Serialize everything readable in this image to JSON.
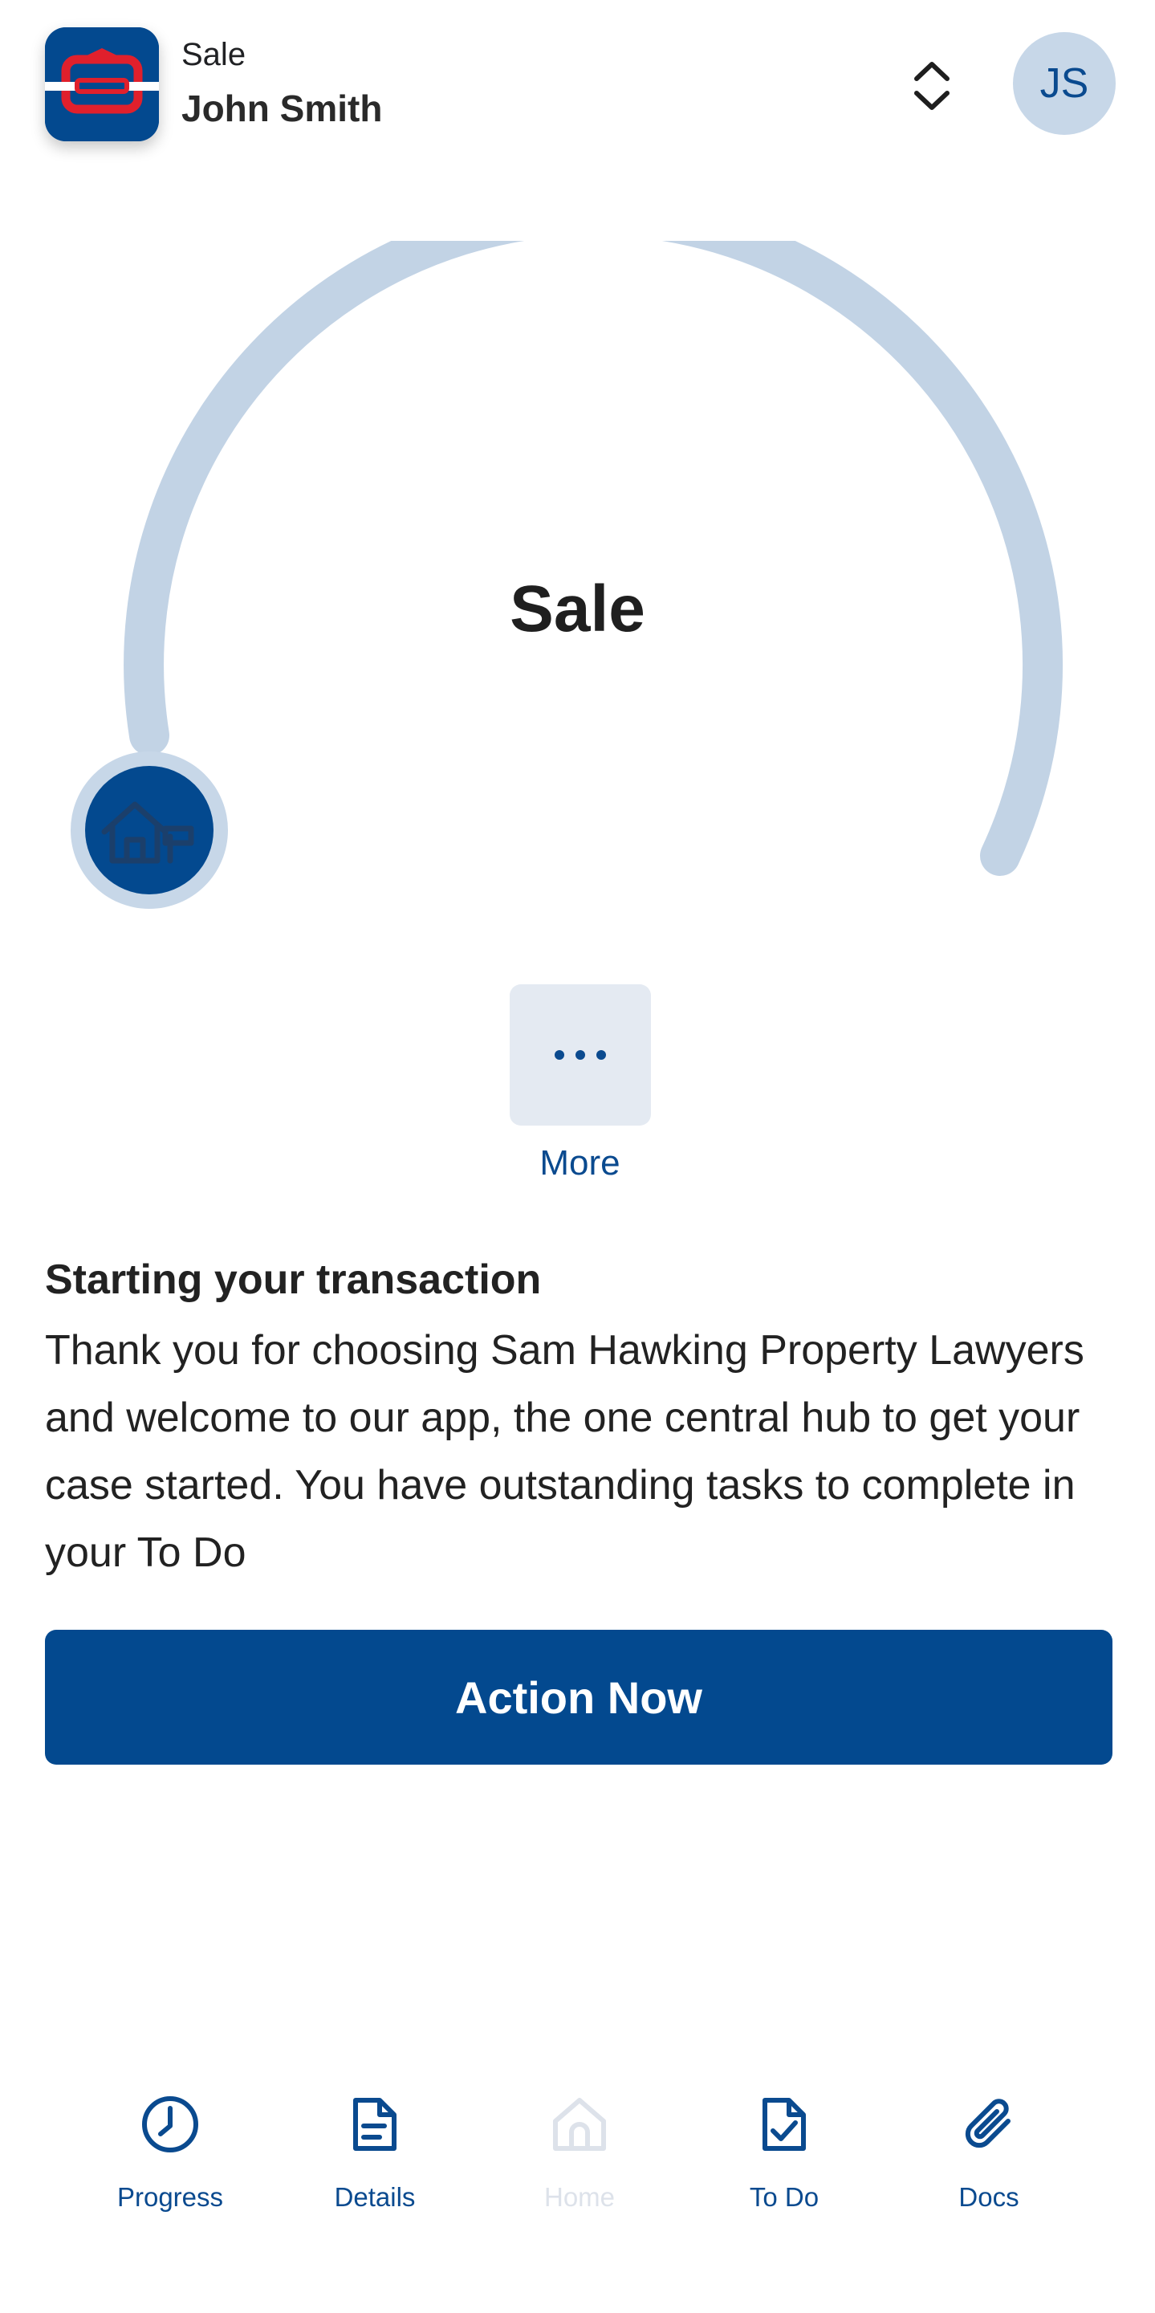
{
  "header": {
    "case_type": "Sale",
    "client_name": "John Smith",
    "avatar_initials": "JS",
    "logo_icon": "firm-logo-icon",
    "switcher_icon": "chevron-up-down-icon"
  },
  "progress": {
    "title": "Sale",
    "completed_fraction": 0,
    "marker_icon": "house-for-sale-icon"
  },
  "more": {
    "label": "More",
    "icon": "ellipsis-icon"
  },
  "info": {
    "title": "Starting your transaction",
    "body": "Thank you for choosing Sam Hawking Property Lawyers and welcome to our app, the one central hub to get your case started. You have outstanding tasks to complete in your To Do"
  },
  "action_button": {
    "label": "Action Now"
  },
  "nav": {
    "items": [
      {
        "label": "Progress",
        "icon": "clock-icon",
        "active": true
      },
      {
        "label": "Details",
        "icon": "document-icon",
        "active": true
      },
      {
        "label": "Home",
        "icon": "home-icon",
        "active": false
      },
      {
        "label": "To Do",
        "icon": "document-check-icon",
        "active": true
      },
      {
        "label": "Docs",
        "icon": "paperclip-icon",
        "active": true
      }
    ]
  },
  "colors": {
    "brand": "#03498f",
    "accent_red": "#e0202c",
    "arc_track": "#c2d3e5",
    "more_bg": "#e4eaf2",
    "disabled": "#dde2ea"
  }
}
